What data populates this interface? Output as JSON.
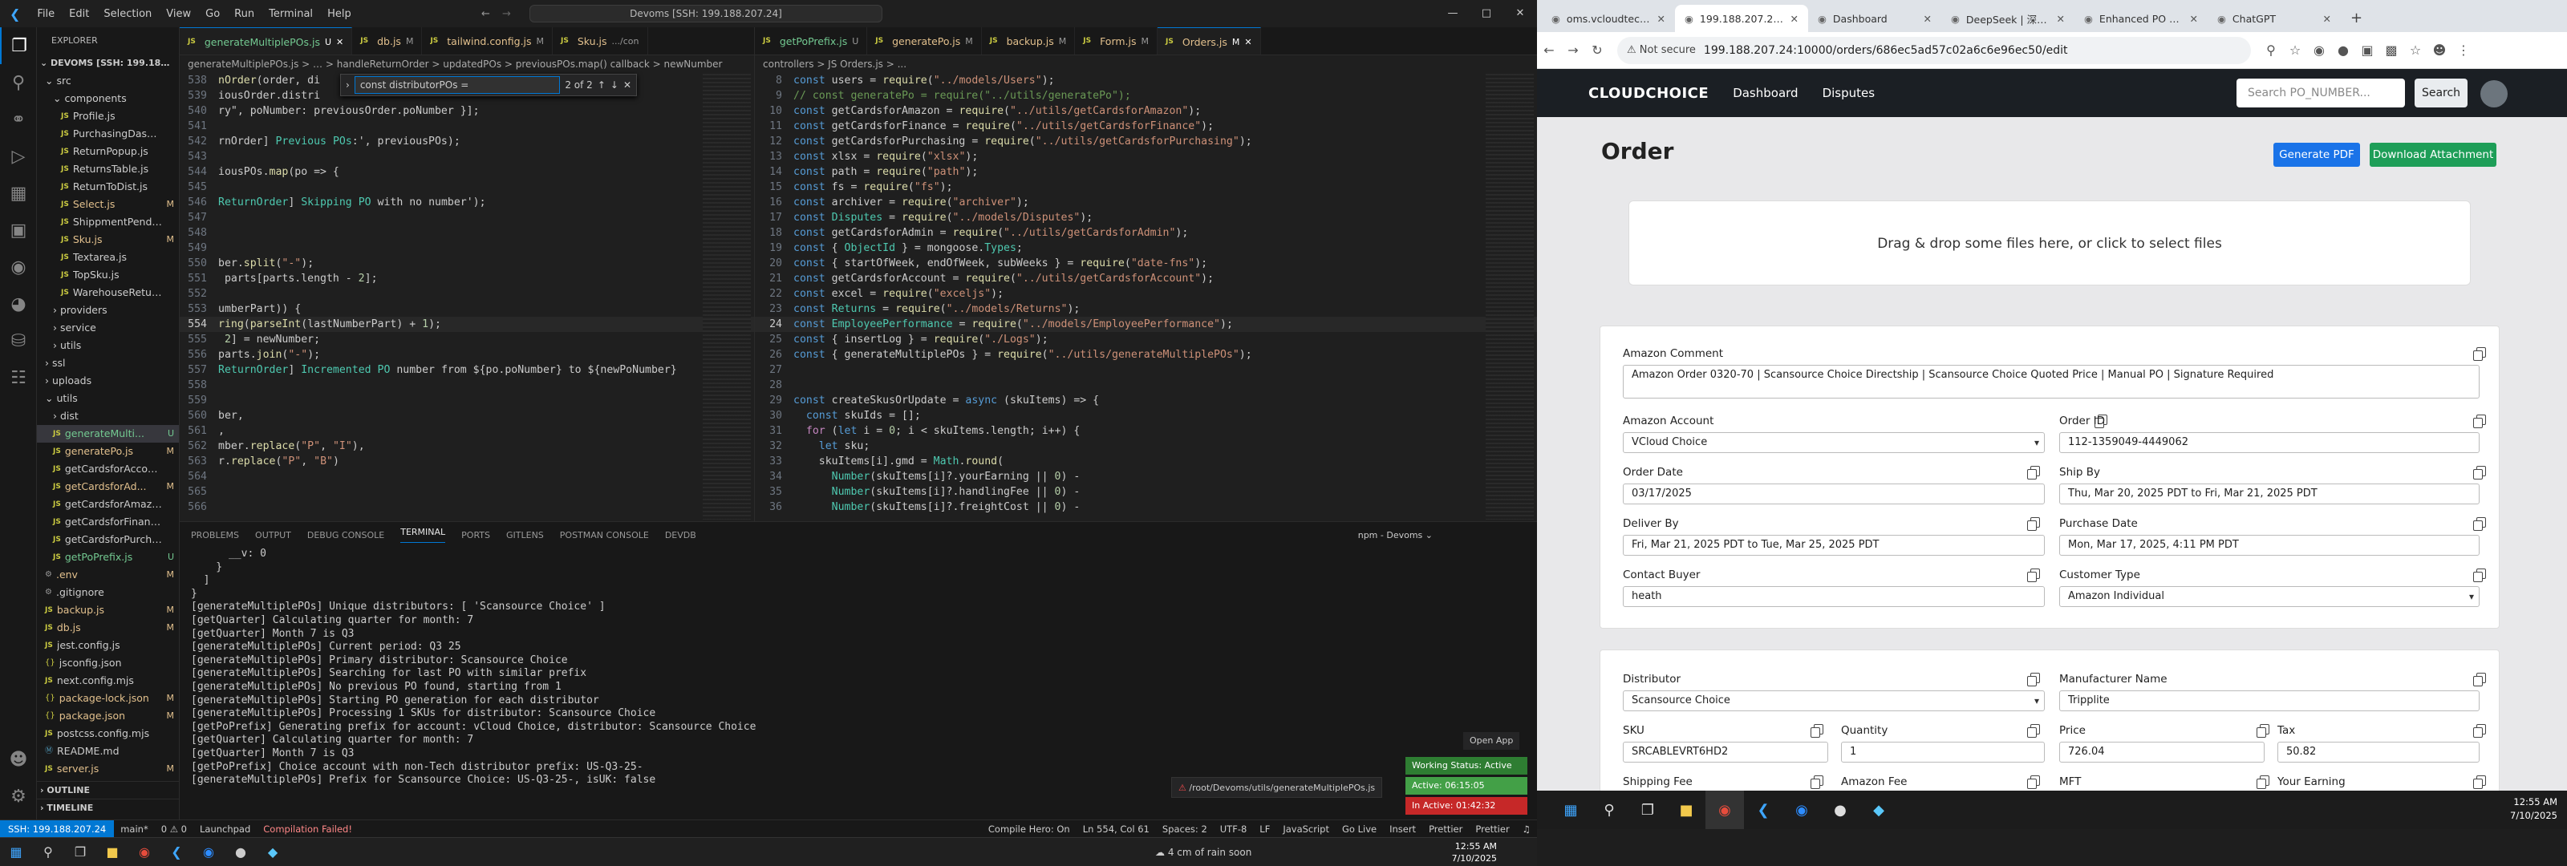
{
  "vscode": {
    "menu": [
      "File",
      "Edit",
      "Selection",
      "View",
      "Go",
      "Run",
      "Terminal",
      "Help"
    ],
    "command_center": "Devoms [SSH: 199.188.207.24]",
    "explorer_title": "EXPLORER",
    "root": "DEVOMS [SSH: 199.188.20...",
    "tree": [
      {
        "name": "src",
        "type": "folder",
        "indent": 1
      },
      {
        "name": "components",
        "type": "folder",
        "indent": 2
      },
      {
        "name": "Profile.js",
        "type": "js",
        "indent": 3,
        "status": ""
      },
      {
        "name": "PurchasingDashbo...",
        "type": "js",
        "indent": 3,
        "status": ""
      },
      {
        "name": "ReturnPopup.js",
        "type": "js",
        "indent": 3,
        "status": ""
      },
      {
        "name": "ReturnsTable.js",
        "type": "js",
        "indent": 3,
        "status": ""
      },
      {
        "name": "ReturnToDist.js",
        "type": "js",
        "indent": 3,
        "status": ""
      },
      {
        "name": "Select.js",
        "type": "js",
        "indent": 3,
        "status": "M"
      },
      {
        "name": "ShippmentPending...",
        "type": "js",
        "indent": 3,
        "status": ""
      },
      {
        "name": "Sku.js",
        "type": "js",
        "indent": 3,
        "status": "M"
      },
      {
        "name": "Textarea.js",
        "type": "js",
        "indent": 3,
        "status": ""
      },
      {
        "name": "TopSku.js",
        "type": "js",
        "indent": 3,
        "status": ""
      },
      {
        "name": "WarehouseReturn.js",
        "type": "js",
        "indent": 3,
        "status": ""
      },
      {
        "name": "providers",
        "type": "folder",
        "indent": 2
      },
      {
        "name": "service",
        "type": "folder",
        "indent": 2
      },
      {
        "name": "utils",
        "type": "folder",
        "indent": 2
      },
      {
        "name": "ssl",
        "type": "folder",
        "indent": 1
      },
      {
        "name": "uploads",
        "type": "folder",
        "indent": 1
      },
      {
        "name": "utils",
        "type": "folder",
        "indent": 1
      },
      {
        "name": "dist",
        "type": "folder",
        "indent": 2
      },
      {
        "name": "generateMulti...",
        "type": "js",
        "indent": 2,
        "status": "U",
        "selected": true
      },
      {
        "name": "generatePo.js",
        "type": "js",
        "indent": 2,
        "status": "M"
      },
      {
        "name": "getCardsforAccount.js",
        "type": "js",
        "indent": 2,
        "status": ""
      },
      {
        "name": "getCardsforAd...",
        "type": "js",
        "indent": 2,
        "status": "M"
      },
      {
        "name": "getCardsforAmazon.js",
        "type": "js",
        "indent": 2,
        "status": ""
      },
      {
        "name": "getCardsforFinance.js",
        "type": "js",
        "indent": 2,
        "status": ""
      },
      {
        "name": "getCardsforPurchasi...",
        "type": "js",
        "indent": 2,
        "status": ""
      },
      {
        "name": "getPoPrefix.js",
        "type": "js",
        "indent": 2,
        "status": "U"
      },
      {
        "name": ".env",
        "type": "dot",
        "indent": 1,
        "status": "M"
      },
      {
        "name": ".gitignore",
        "type": "dot",
        "indent": 1,
        "status": ""
      },
      {
        "name": "backup.js",
        "type": "js",
        "indent": 1,
        "status": "M"
      },
      {
        "name": "db.js",
        "type": "js",
        "indent": 1,
        "status": "M"
      },
      {
        "name": "jest.config.js",
        "type": "js",
        "indent": 1,
        "status": ""
      },
      {
        "name": "jsconfig.json",
        "type": "json",
        "indent": 1,
        "status": ""
      },
      {
        "name": "next.config.mjs",
        "type": "js",
        "indent": 1,
        "status": ""
      },
      {
        "name": "package-lock.json",
        "type": "json",
        "indent": 1,
        "status": "M"
      },
      {
        "name": "package.json",
        "type": "json",
        "indent": 1,
        "status": "M"
      },
      {
        "name": "postcss.config.mjs",
        "type": "js",
        "indent": 1,
        "status": ""
      },
      {
        "name": "README.md",
        "type": "md",
        "indent": 1,
        "status": ""
      },
      {
        "name": "server.js",
        "type": "js",
        "indent": 1,
        "status": "M"
      }
    ],
    "outline": "OUTLINE",
    "timeline": "TIMELINE",
    "tabs_left": [
      {
        "label": "generateMultiplePOs.js",
        "status": "U",
        "active": true
      },
      {
        "label": "db.js",
        "status": "M"
      },
      {
        "label": "tailwind.config.js",
        "status": "M"
      },
      {
        "label": "Sku.js",
        "status": ".../con"
      }
    ],
    "tabs_right": [
      {
        "label": "getPoPrefix.js",
        "status": "U"
      },
      {
        "label": "generatePo.js",
        "status": "M"
      },
      {
        "label": "backup.js",
        "status": "M"
      },
      {
        "label": "Form.js",
        "status": "M"
      },
      {
        "label": "Orders.js",
        "status": "M",
        "active": true
      }
    ],
    "breadcrumb_left": "generateMultiplePOs.js > … > handleReturnOrder > updatedPOs > previousPOs.map() callback > newNumber",
    "breadcrumb_right": "controllers > JS Orders.js > ...",
    "find_query": "const distributorPOs = ",
    "find_count": "2 of 2",
    "panel_tabs": [
      "PROBLEMS",
      "OUTPUT",
      "DEBUG CONSOLE",
      "TERMINAL",
      "PORTS",
      "GITLENS",
      "POSTMAN CONSOLE",
      "DEVDB"
    ],
    "terminal_name": "npm - Devoms",
    "notification": "/root/Devoms/utils/generateMultiplePOs.js",
    "open_app": "Open App",
    "working_status": "Working Status: Active",
    "active_time": "Active: 06:15:05",
    "inactive_time": "In Active: 01:42:32",
    "statusbar": {
      "remote": "SSH: 199.188.207.24",
      "branch": "main*",
      "errors": "0 ⚠ 0",
      "launchpad": "Launchpad",
      "compile": "Compilation Failed!",
      "compile_hero": "Compile Hero: On",
      "position": "Ln 554, Col 61",
      "spaces": "Spaces: 2",
      "encoding": "UTF-8",
      "eol": "LF",
      "lang": "JavaScript",
      "golive": "Go Live",
      "insert": "Insert",
      "prettier1": "Prettier",
      "prettier2": "Prettier"
    },
    "weather": "4 cm of rain soon",
    "clock_time": "12:55 AM",
    "clock_date": "7/10/2025"
  },
  "code_left": [
    {
      "n": "538",
      "t": "nOrder(order, di"
    },
    {
      "n": "539",
      "t": "iousOrder.distri"
    },
    {
      "n": "540",
      "t": "ry\", poNumber: previousOrder.poNumber }];"
    },
    {
      "n": "541",
      "t": ""
    },
    {
      "n": "542",
      "t": "rnOrder] Previous POs:', previousPOs);"
    },
    {
      "n": "543",
      "t": ""
    },
    {
      "n": "544",
      "t": "iousPOs.map(po => {"
    },
    {
      "n": "545",
      "t": ""
    },
    {
      "n": "546",
      "t": "ReturnOrder] Skipping PO with no number');"
    },
    {
      "n": "547",
      "t": ""
    },
    {
      "n": "548",
      "t": ""
    },
    {
      "n": "549",
      "t": ""
    },
    {
      "n": "550",
      "t": "ber.split(\"-\");"
    },
    {
      "n": "551",
      "t": " parts[parts.length - 2];"
    },
    {
      "n": "552",
      "t": ""
    },
    {
      "n": "553",
      "t": "umberPart)) {"
    },
    {
      "n": "554",
      "t": "ring(parseInt(lastNumberPart) + 1);"
    },
    {
      "n": "555",
      "t": " 2] = newNumber;"
    },
    {
      "n": "556",
      "t": "parts.join(\"-\");"
    },
    {
      "n": "557",
      "t": "ReturnOrder] Incremented PO number from ${po.poNumber} to ${newPoNumber}"
    },
    {
      "n": "558",
      "t": ""
    },
    {
      "n": "559",
      "t": ""
    },
    {
      "n": "560",
      "t": "ber,"
    },
    {
      "n": "561",
      "t": ","
    },
    {
      "n": "562",
      "t": "mber.replace(\"P\", \"I\"),"
    },
    {
      "n": "563",
      "t": "r.replace(\"P\", \"B\")"
    },
    {
      "n": "564",
      "t": ""
    },
    {
      "n": "565",
      "t": ""
    },
    {
      "n": "566",
      "t": ""
    }
  ],
  "code_right": [
    {
      "n": "8",
      "t": "const users = require(\"../models/Users\");"
    },
    {
      "n": "9",
      "t": "// const generatePo = require(\"../utils/generatePo\");"
    },
    {
      "n": "10",
      "t": "const getCardsforAmazon = require(\"../utils/getCardsforAmazon\");"
    },
    {
      "n": "11",
      "t": "const getCardsforFinance = require(\"../utils/getCardsforFinance\");"
    },
    {
      "n": "12",
      "t": "const getCardsforPurchasing = require(\"../utils/getCardsforPurchasing\");"
    },
    {
      "n": "13",
      "t": "const xlsx = require(\"xlsx\");"
    },
    {
      "n": "14",
      "t": "const path = require(\"path\");"
    },
    {
      "n": "15",
      "t": "const fs = require(\"fs\");"
    },
    {
      "n": "16",
      "t": "const archiver = require(\"archiver\");"
    },
    {
      "n": "17",
      "t": "const Disputes = require(\"../models/Disputes\");"
    },
    {
      "n": "18",
      "t": "const getCardsforAdmin = require(\"../utils/getCardsforAdmin\");"
    },
    {
      "n": "19",
      "t": "const { ObjectId } = mongoose.Types;"
    },
    {
      "n": "20",
      "t": "const { startOfWeek, endOfWeek, subWeeks } = require(\"date-fns\");"
    },
    {
      "n": "21",
      "t": "const getCardsforAccount = require(\"../utils/getCardsforAccount\");"
    },
    {
      "n": "22",
      "t": "const excel = require(\"exceljs\");"
    },
    {
      "n": "23",
      "t": "const Returns = require(\"../models/Returns\");"
    },
    {
      "n": "24",
      "t": "const EmployeePerformance = require(\"../models/EmployeePerformance\");"
    },
    {
      "n": "25",
      "t": "const { insertLog } = require(\"./Logs\");"
    },
    {
      "n": "26",
      "t": "const { generateMultiplePOs } = require(\"../utils/generateMultiplePOs\");"
    },
    {
      "n": "27",
      "t": ""
    },
    {
      "n": "28",
      "t": ""
    },
    {
      "n": "29",
      "t": "const createSkusOrUpdate = async (skuItems) => {"
    },
    {
      "n": "30",
      "t": "  const skuIds = [];"
    },
    {
      "n": "31",
      "t": "  for (let i = 0; i < skuItems.length; i++) {"
    },
    {
      "n": "32",
      "t": "    let sku;"
    },
    {
      "n": "33",
      "t": "    skuItems[i].gmd = Math.round("
    },
    {
      "n": "34",
      "t": "      Number(skuItems[i]?.yourEarning || 0) -"
    },
    {
      "n": "35",
      "t": "      Number(skuItems[i]?.handlingFee || 0) -"
    },
    {
      "n": "36",
      "t": "      Number(skuItems[i]?.freightCost || 0) -"
    }
  ],
  "terminal_lines": [
    "      __v: 0",
    "    }",
    "  ]",
    "}",
    "[generateMultiplePOs] Unique distributors: [ 'Scansource Choice' ]",
    "[getQuarter] Calculating quarter for month: 7",
    "[getQuarter] Month 7 is Q3",
    "[generateMultiplePOs] Current period: Q3 25",
    "[generateMultiplePOs] Primary distributor: Scansource Choice",
    "[generateMultiplePOs] Searching for last PO with similar prefix",
    "[generateMultiplePOs] No previous PO found, starting from 1",
    "[generateMultiplePOs] Starting PO generation for each distributor",
    "[generateMultiplePOs] Processing 1 SKUs for distributor: Scansource Choice",
    "[getPoPrefix] Generating prefix for account: vCloud Choice, distributor: Scansource Choice",
    "[getQuarter] Calculating quarter for month: 7",
    "[getQuarter] Month 7 is Q3",
    "[getPoPrefix] Choice account with non-Tech distributor prefix: US-Q3-25-",
    "[generateMultiplePOs] Prefix for Scansource Choice: US-Q3-25-, isUK: false"
  ],
  "browser": {
    "tabs": [
      {
        "title": "oms.vcloudtech.u...",
        "active": false
      },
      {
        "title": "199.188.207.24:10...",
        "active": true
      },
      {
        "title": "Dashboard",
        "active": false
      },
      {
        "title": "DeepSeek | 深度求...",
        "active": false
      },
      {
        "title": "Enhanced PO Gen...",
        "active": false
      },
      {
        "title": "ChatGPT",
        "active": false
      }
    ],
    "not_secure": "Not secure",
    "url": "199.188.207.24:10000/orders/686ec5ad57c02a6c6e96ec50/edit",
    "brand": "CLOUDCHOICE",
    "nav": [
      "Dashboard",
      "Disputes"
    ],
    "search_placeholder": "Search PO_NUMBER...",
    "search_button": "Search"
  },
  "order": {
    "heading": "Order",
    "generate_pdf": "Generate PDF",
    "download_attachment": "Download Attachment",
    "dropzone": "Drag & drop some files here, or click to select files",
    "amazon_comment_label": "Amazon Comment",
    "amazon_comment": "Amazon Order 0320-70 | Scansource Choice Directship | Scansource Choice Quoted Price | Manual PO | Signature Required",
    "amazon_account_label": "Amazon Account",
    "amazon_account": "VCloud Choice",
    "order_id_label": "Order ID",
    "order_id": "112-1359049-4449062",
    "order_date_label": "Order Date",
    "order_date": "03/17/2025",
    "ship_by_label": "Ship By",
    "ship_by": "Thu, Mar 20, 2025 PDT to Fri, Mar 21, 2025 PDT",
    "deliver_by_label": "Deliver By",
    "deliver_by": "Fri, Mar 21, 2025 PDT to Tue, Mar 25, 2025 PDT",
    "purchase_date_label": "Purchase Date",
    "purchase_date": "Mon, Mar 17, 2025, 4:11 PM PDT",
    "contact_buyer_label": "Contact Buyer",
    "contact_buyer": "heath",
    "customer_type_label": "Customer Type",
    "customer_type": "Amazon Individual",
    "distributor_label": "Distributor",
    "distributor": "Scansource Choice",
    "manufacturer_label": "Manufacturer Name",
    "manufacturer": "Tripplite",
    "sku_label": "SKU",
    "sku": "SRCABLEVRT6HD2",
    "quantity_label": "Quantity",
    "quantity": "1",
    "price_label": "Price",
    "price": "726.04",
    "tax_label": "Tax",
    "tax": "50.82",
    "shipping_fee_label": "Shipping Fee",
    "amazon_fee_label": "Amazon Fee",
    "mft_label": "MFT",
    "your_earning_label": "Your Earning"
  },
  "colors": {
    "accent": "#0078d4",
    "pdf_btn": "#1a73e8",
    "download_btn": "#1e9e58",
    "status_active": "#2e7d32",
    "status_inactive": "#c62828"
  }
}
